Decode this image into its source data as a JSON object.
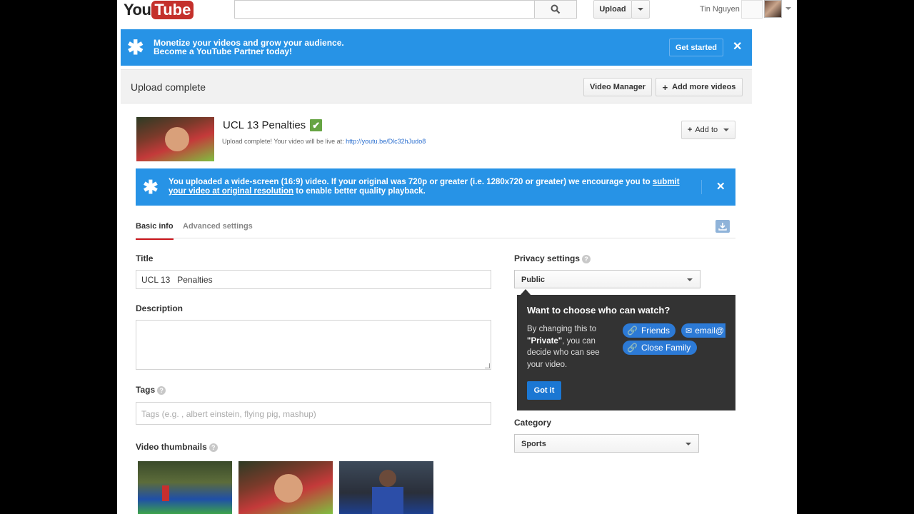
{
  "header": {
    "logo_you": "You",
    "logo_tube": "Tube",
    "upload_label": "Upload",
    "username": "Tin Nguyen"
  },
  "partner_banner": {
    "line1": "Monetize your videos and grow your audience.",
    "line2": "Become a YouTube Partner today!",
    "cta": "Get started"
  },
  "upload_bar": {
    "status": "Upload complete",
    "video_manager": "Video Manager",
    "add_more": "Add more videos"
  },
  "video": {
    "title": "UCL 13 Penalties",
    "status_prefix": "Upload complete! Your video will be live at:",
    "link": "http://youtu.be/Dlc32hJudo8",
    "add_to": "Add to"
  },
  "widescreen_banner": {
    "text_before": "You uploaded a wide-screen (16:9) video. If your original was 720p or greater (i.e. 1280x720 or greater) we encourage you to",
    "link_text": "submit your video at original resolution",
    "text_after": "to enable better quality playback."
  },
  "tabs": [
    {
      "label": "Basic info",
      "active": true
    },
    {
      "label": "Advanced settings",
      "active": false
    }
  ],
  "form": {
    "title_label": "Title",
    "title_value": "UCL 13   Penalties",
    "description_label": "Description",
    "tags_label": "Tags",
    "tags_placeholder": "Tags (e.g. , albert einstein, flying pig, mashup)",
    "thumbnails_label": "Video thumbnails",
    "privacy_label": "Privacy settings",
    "privacy_value": "Public",
    "category_label": "Category",
    "category_value": "Sports"
  },
  "tooltip": {
    "heading": "Want to choose who can watch?",
    "body_1": "By changing this to",
    "body_bold": "\"Private\"",
    "body_2": ", you can decide who can see your video.",
    "chip_friends": "Friends",
    "chip_email": "email@",
    "chip_family": "Close Family",
    "got_it": "Got it"
  },
  "colors": {
    "banner_blue": "#2793e6",
    "youtube_red": "#c4302b",
    "tab_active_red": "#cc181e",
    "link_blue": "#2a6ecf",
    "tooltip_bg": "#333333",
    "check_green": "#66a443"
  }
}
